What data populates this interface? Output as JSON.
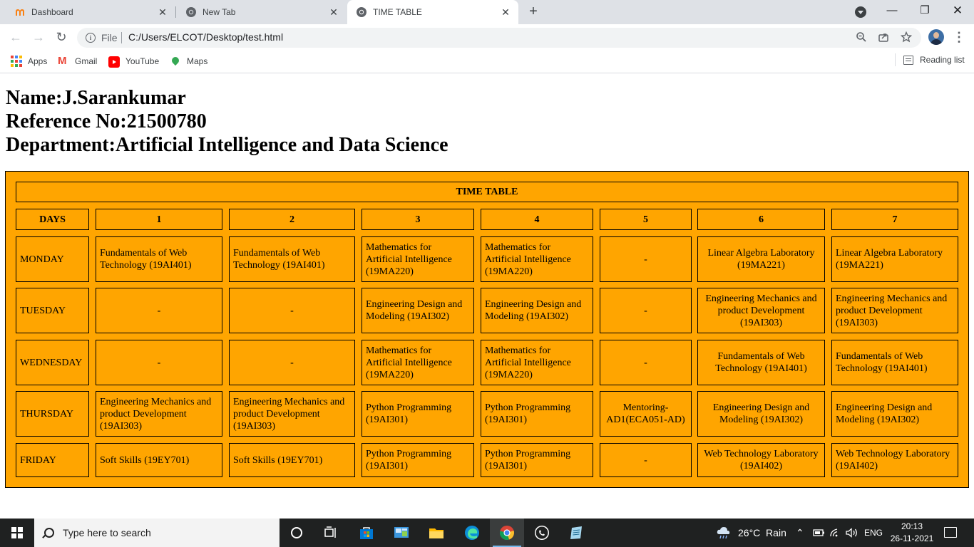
{
  "browser": {
    "tabs": [
      {
        "label": "Dashboard",
        "icon": "moodle-icon",
        "active": false
      },
      {
        "label": "New Tab",
        "icon": "chrome-icon",
        "active": false
      },
      {
        "label": "TIME TABLE",
        "icon": "globe-icon",
        "active": true
      }
    ],
    "address_bar": {
      "scheme_label": "File",
      "url": "C:/Users/ELCOT/Desktop/test.html"
    },
    "bookmarks": [
      {
        "label": "Apps",
        "icon": "apps-grid-icon"
      },
      {
        "label": "Gmail",
        "icon": "gmail-icon"
      },
      {
        "label": "YouTube",
        "icon": "youtube-icon"
      },
      {
        "label": "Maps",
        "icon": "maps-icon"
      }
    ],
    "reading_list": "Reading list"
  },
  "page": {
    "name_line": "Name:J.Sarankumar",
    "ref_line": "Reference No:21500780",
    "dept_line": "Department:Artificial Intelligence and Data Science",
    "background_color": "#ffa500",
    "timetable": {
      "title": "TIME TABLE",
      "days_header": "DAYS",
      "periods": [
        "1",
        "2",
        "3",
        "4",
        "5",
        "6",
        "7"
      ],
      "rows": [
        {
          "day": "MONDAY",
          "cells": [
            "Fundamentals of Web Technology (19AI401)",
            "Fundamentals of Web Technology (19AI401)",
            "Mathematics for Artificial Intelligence (19MA220)",
            "Mathematics for Artificial Intelligence (19MA220)",
            "-",
            "Linear Algebra Laboratory (19MA221)",
            "Linear Algebra Laboratory (19MA221)"
          ]
        },
        {
          "day": "TUESDAY",
          "cells": [
            "-",
            "-",
            "Engineering Design and Modeling (19AI302)",
            "Engineering Design and Modeling (19AI302)",
            "-",
            "Engineering Mechanics and product Development (19AI303)",
            "Engineering Mechanics and product Development (19AI303)"
          ]
        },
        {
          "day": "WEDNESDAY",
          "cells": [
            "-",
            "-",
            "Mathematics for Artificial Intelligence (19MA220)",
            "Mathematics for Artificial Intelligence (19MA220)",
            "-",
            "Fundamentals of Web Technology (19AI401)",
            "Fundamentals of Web Technology (19AI401)"
          ]
        },
        {
          "day": "THURSDAY",
          "cells": [
            "Engineering Mechanics and product Development (19AI303)",
            "Engineering Mechanics and product Development (19AI303)",
            "Python Programming (19AI301)",
            "Python Programming (19AI301)",
            "Mentoring-AD1(ECA051-AD)",
            "Engineering Design and Modeling (19AI302)",
            "Engineering Design and Modeling (19AI302)"
          ]
        },
        {
          "day": "FRIDAY",
          "cells": [
            "Soft Skills (19EY701)",
            "Soft Skills (19EY701)",
            "Python Programming (19AI301)",
            "Python Programming (19AI301)",
            "-",
            "Web Technology Laboratory (19AI402)",
            "Web Technology Laboratory (19AI402)"
          ]
        }
      ]
    }
  },
  "taskbar": {
    "search_placeholder": "Type here to search",
    "weather": "26°C  Rain",
    "language": "ENG",
    "time": "20:13",
    "date": "26-11-2021",
    "pinned": [
      "cortana-icon",
      "task-view-icon",
      "store-icon",
      "control-panel-icon",
      "file-explorer-icon",
      "edge-icon",
      "chrome-icon",
      "whatsapp-icon",
      "notepad-icon"
    ]
  }
}
